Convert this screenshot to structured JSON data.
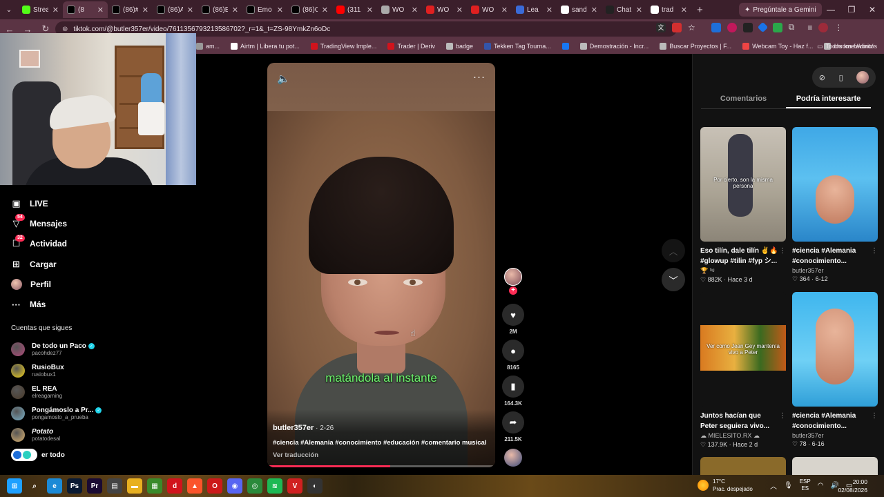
{
  "browser": {
    "tabs": [
      {
        "label": "Strea",
        "color": "#53fc18",
        "active": false
      },
      {
        "label": "(8",
        "color": "#000000",
        "active": true
      },
      {
        "label": "(86)#",
        "color": "#000000",
        "active": false
      },
      {
        "label": "(86)A",
        "color": "#000000",
        "active": false
      },
      {
        "label": "(86)E",
        "color": "#000000",
        "active": false
      },
      {
        "label": "Emo",
        "color": "#000000",
        "active": false
      },
      {
        "label": "(86)C",
        "color": "#000000",
        "active": false
      },
      {
        "label": "(311",
        "color": "#ff0000",
        "active": false
      },
      {
        "label": "WO",
        "color": "#aaaaaa",
        "active": false
      },
      {
        "label": "WO",
        "color": "#e02020",
        "active": false
      },
      {
        "label": "WO",
        "color": "#e02020",
        "active": false
      },
      {
        "label": "Lea",
        "color": "#3a6bd8",
        "active": false
      },
      {
        "label": "sand",
        "color": "#ffffff",
        "active": false
      },
      {
        "label": "Chat",
        "color": "#222222",
        "active": false
      },
      {
        "label": "trad",
        "color": "#ffffff",
        "active": false
      }
    ],
    "new_tab": "+",
    "gemini": "Pregúntale a Gemini",
    "url": "tiktok.com/@butler357er/video/7611356793213586702?_r=1&_t=ZS-98YmkZn6oDc",
    "bookmarks": [
      {
        "label": "am...",
        "color": "#999999"
      },
      {
        "label": "Airtm | Libera tu pot...",
        "color": "#ffffff"
      },
      {
        "label": "TradingView Imple...",
        "color": "#d1131c"
      },
      {
        "label": "Trader | Deriv",
        "color": "#d1131c"
      },
      {
        "label": "badge",
        "color": "#bbbbbb"
      },
      {
        "label": "Tekken Tag Tourna...",
        "color": "#3355aa"
      },
      {
        "label": "",
        "color": "#1877f2"
      },
      {
        "label": "Demostración - Incr...",
        "color": "#bbbbbb"
      },
      {
        "label": "Buscar Proyectos | F...",
        "color": "#bbbbbb"
      },
      {
        "label": "Webcam Toy - Haz f...",
        "color": "#e44"
      },
      {
        "label": "chrome://dino/",
        "color": "#bbbbbb"
      }
    ],
    "bookmarks_more": "»",
    "all_favorites": "Todos los favoritos"
  },
  "sidebar": {
    "nav": [
      {
        "label": "LIVE",
        "icon": "live-icon",
        "glyph": "▣",
        "badge": ""
      },
      {
        "label": "Mensajes",
        "icon": "messages-icon",
        "glyph": "▽",
        "badge": "54"
      },
      {
        "label": "Actividad",
        "icon": "activity-icon",
        "glyph": "☐",
        "badge": "32"
      },
      {
        "label": "Cargar",
        "icon": "upload-icon",
        "glyph": "⊞",
        "badge": ""
      },
      {
        "label": "Perfil",
        "icon": "profile-avatar",
        "glyph": "",
        "badge": ""
      },
      {
        "label": "Más",
        "icon": "more-icon",
        "glyph": "···",
        "badge": ""
      }
    ],
    "following_title": "Cuentas que sigues",
    "following": [
      {
        "name": "De todo un Paco",
        "handle": "pacohdez77",
        "verified": true,
        "italic": false,
        "color": "#b04a7a"
      },
      {
        "name": "RusioBux",
        "handle": "rusiobux1",
        "verified": false,
        "italic": false,
        "color": "#f2d21b"
      },
      {
        "name": "EL REA",
        "handle": "elreagaming",
        "verified": false,
        "italic": false,
        "color": "#4a3a2a"
      },
      {
        "name": "Pongámoslo a Pr...",
        "handle": "pongamoslo_a_prueba",
        "verified": true,
        "italic": false,
        "color": "#7ab0c8"
      },
      {
        "name": "Potato",
        "handle": "potatodesal",
        "verified": false,
        "italic": true,
        "color": "#d8b070"
      }
    ],
    "see_all": "er todo"
  },
  "video": {
    "caption": "matándola al instante",
    "author": "butler357er",
    "date": " · 2-26",
    "hashtags": "#ciencia #Alemania #conocimiento #educación #comentario musical",
    "translate": "Ver traducción",
    "progress_pct": 54,
    "likes": "2M",
    "comments": "8165",
    "saves": "164.3K",
    "shares": "211.5K"
  },
  "panel": {
    "tabs": [
      "Comentarios",
      "Podría interesarte"
    ],
    "active_tab": 1,
    "cards": [
      {
        "title": "Eso tilín, dale tilín ✌️🔥 #glowup #tilin #fyp シ...",
        "author": "🏆 ᶠᶦᵍ",
        "stats": "♡ 882K · Hace 3 d",
        "overlay": "Por cierto, son la misma persona",
        "bg": "linear-gradient(180deg,#c8c1b6,#a9a293 60%,#8c8578)"
      },
      {
        "title": "#ciencia #Alemania #conocimiento...",
        "author": "butler357er",
        "stats": "♡ 364 · 6-12",
        "overlay": "",
        "bg": "linear-gradient(180deg,#3fa8e6,#5cc0f0 45%,#2a86c9)"
      },
      {
        "title": "Juntos hacían que Peter seguiera vivo...",
        "author": "☁ MIELESITO.RX ☁",
        "stats": "♡ 137.9K · Hace 2 d",
        "overlay": "Ver como Jean Gey mantenía vivo a Peter",
        "bg": "#121212"
      },
      {
        "title": "#ciencia #Alemania #conocimiento...",
        "author": "butler357er",
        "stats": "♡ 78 · 6-16",
        "overlay": "",
        "bg": "linear-gradient(180deg,#3fb6ee,#6fd0f5 60%,#2f9fd8)"
      }
    ]
  },
  "taskbar": {
    "apps": [
      {
        "name": "windows-start-icon",
        "label": "⊞",
        "color": "#1ea0ff"
      },
      {
        "name": "search-icon",
        "label": "⌕",
        "color": "transparent"
      },
      {
        "name": "edge-icon",
        "label": "e",
        "color": "#1b8ad6"
      },
      {
        "name": "photoshop-icon",
        "label": "Ps",
        "color": "#0a1a33"
      },
      {
        "name": "premiere-icon",
        "label": "Pr",
        "color": "#1a0a33"
      },
      {
        "name": "store-icon",
        "label": "▤",
        "color": "#444444"
      },
      {
        "name": "explorer-icon",
        "label": "▬",
        "color": "#e8b020"
      },
      {
        "name": "minecraft-icon",
        "label": "▦",
        "color": "#3a8a2a"
      },
      {
        "name": "deriv-icon",
        "label": "d",
        "color": "#d1131c"
      },
      {
        "name": "brave-icon",
        "label": "▲",
        "color": "#fb542b"
      },
      {
        "name": "opera-icon",
        "label": "O",
        "color": "#cc1a1a"
      },
      {
        "name": "discord-icon",
        "label": "◉",
        "color": "#5865f2"
      },
      {
        "name": "chrome-icon",
        "label": "◎",
        "color": "#2a8a3a"
      },
      {
        "name": "spotify-icon",
        "label": "≋",
        "color": "#1db954"
      },
      {
        "name": "voicemod-icon",
        "label": "V",
        "color": "#d02020"
      },
      {
        "name": "obs-icon",
        "label": "◐",
        "color": "#333333"
      }
    ],
    "temp": "17°C",
    "weather": "Prac. despejado",
    "lang1": "ESP",
    "lang2": "ES",
    "time": "20:00",
    "date": "02/08/2026"
  }
}
